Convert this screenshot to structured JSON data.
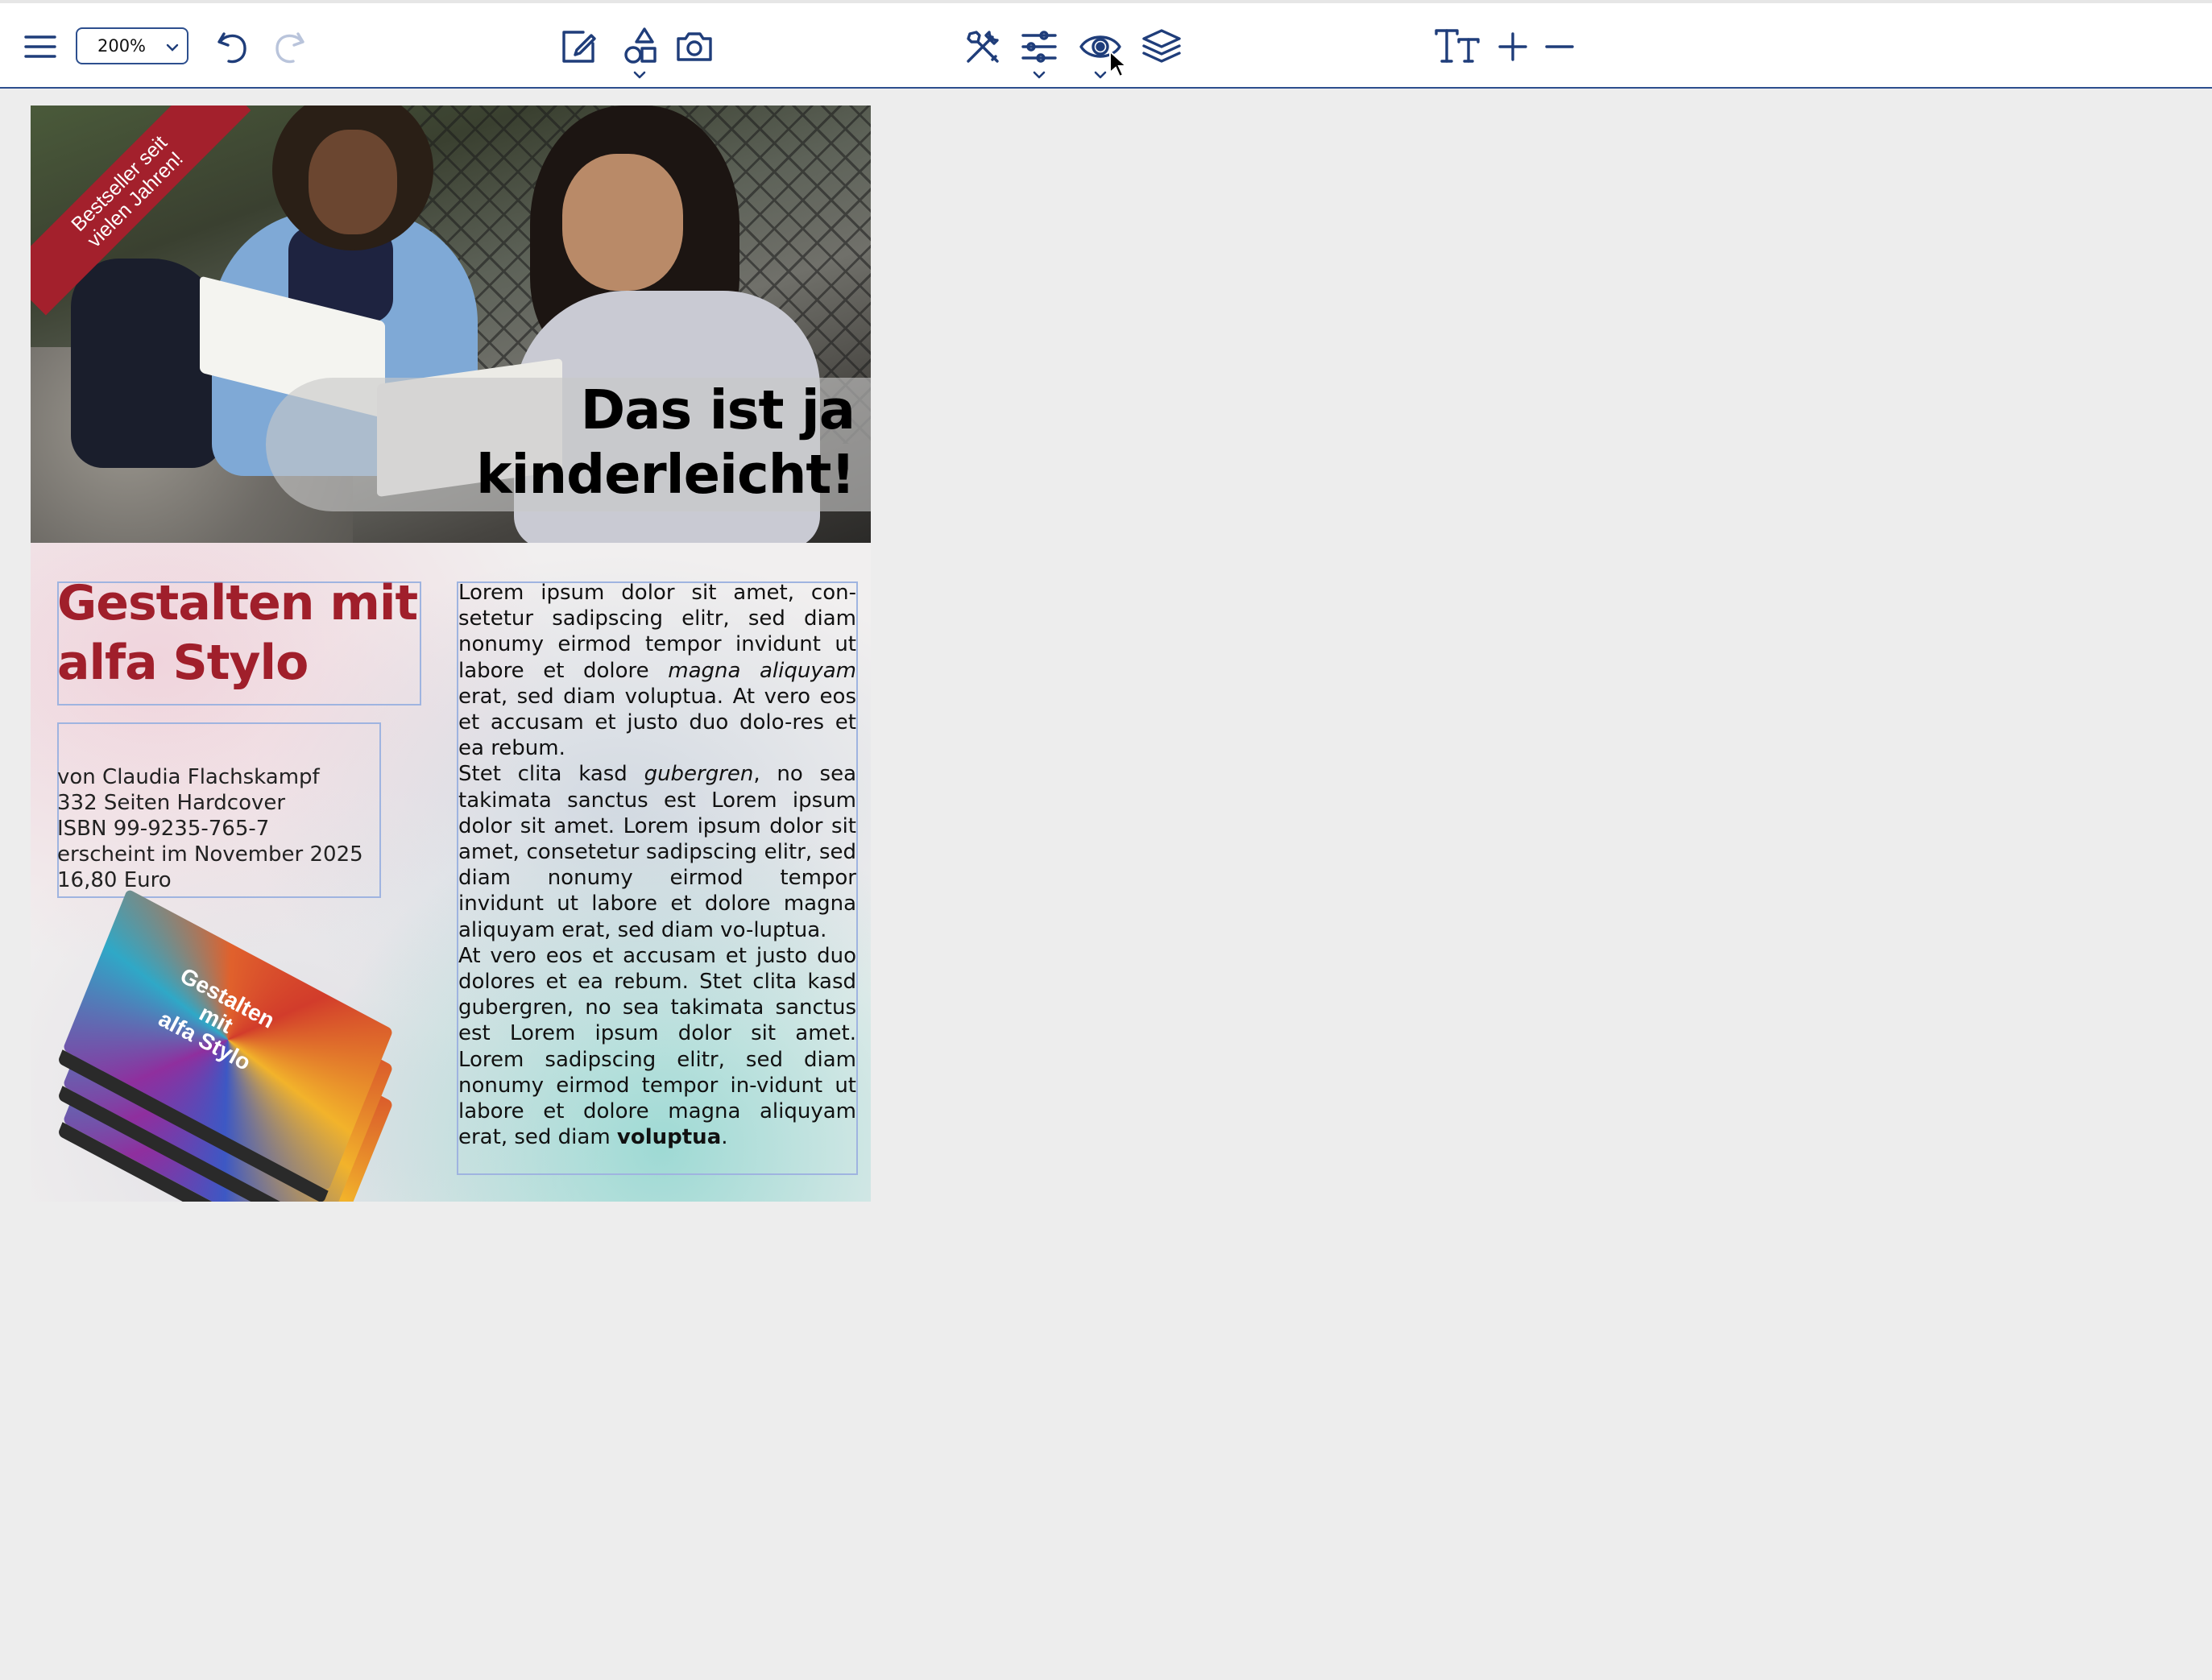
{
  "toolbar": {
    "zoom_value": "200%",
    "icons": [
      "menu-icon",
      "undo-icon",
      "redo-icon",
      "edit-icon",
      "shapes-icon",
      "camera-icon",
      "tools-icon",
      "sliders-icon",
      "eye-icon",
      "layers-icon",
      "text-size-icon",
      "plus-icon",
      "minus-icon"
    ],
    "accent_color": "#1f3d7a",
    "disabled_color": "#b9c4db"
  },
  "document": {
    "banner": {
      "line1": "Bestseller seit",
      "line2": "vielen Jahren!"
    },
    "headline": {
      "line1": "Das ist ja",
      "line2": "kinderleicht!"
    },
    "title": {
      "line1": "Gestalten mit",
      "line2": "alfa Stylo"
    },
    "info": [
      "von Claudia Flachskampf",
      "332 Seiten Hardcover",
      "ISBN 99-9235-765-7",
      "erscheint im November 2025",
      "16,80 Euro"
    ],
    "body": {
      "p1_a": "Lorem ipsum dolor sit amet, con-setetur sadipscing elitr, sed diam nonumy eirmod tempor invidunt ut labore et dolore ",
      "p1_italic": "magna aliquyam",
      "p1_b": " erat, sed diam voluptua. At vero eos et accusam et justo duo dolo-res et ea rebum.",
      "p2_a": "Stet clita kasd ",
      "p2_italic": "gubergren",
      "p2_b": ", no sea takimata sanctus est Lorem ipsum dolor sit amet. Lorem ipsum dolor sit amet, consetetur sadipscing elitr, sed diam nonumy eirmod tempor invidunt ut labore et dolore magna aliquyam erat, sed diam vo-luptua.",
      "p3_a": "At vero eos et accusam et justo duo dolores et ea rebum. Stet clita kasd gubergren, no sea takimata sanctus est Lorem ipsum dolor sit amet. Lorem sadipscing elitr, sed diam nonumy eirmod tempor in-vidunt ut labore et dolore magna aliquyam erat, sed diam ",
      "p3_bold": "voluptua",
      "p3_end": "."
    },
    "book_cover": {
      "title_line1": "Gestalten",
      "title_line2": "mit",
      "title_line3": "alfa Stylo"
    },
    "colors": {
      "banner": "#a3202c",
      "title": "#a01f2b",
      "frame": "#9fb4e0"
    }
  }
}
